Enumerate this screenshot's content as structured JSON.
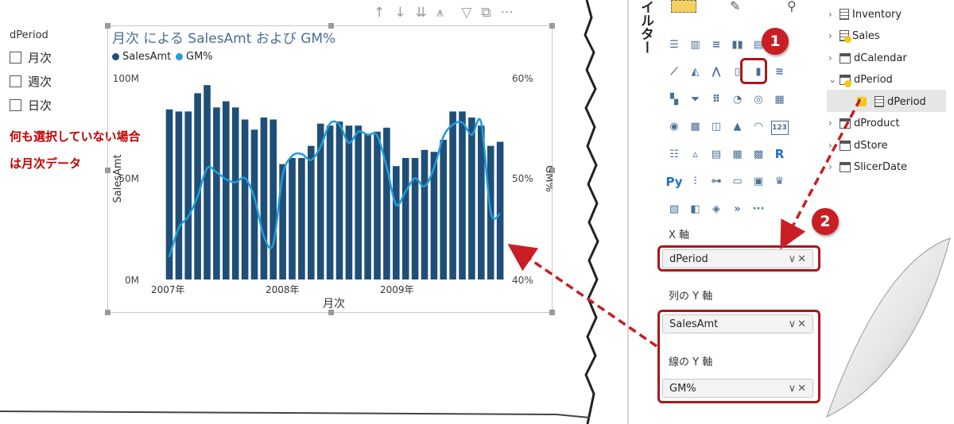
{
  "slicer": {
    "title": "dPeriod",
    "items": [
      "月次",
      "週次",
      "日次"
    ],
    "note_line1": "何も選択していない場合",
    "note_line2": "は月次データ"
  },
  "visual": {
    "title": "月次 による SalesAmt および GM%",
    "legend": [
      {
        "name": "SalesAmt",
        "color": "#1f4e79"
      },
      {
        "name": "GM%",
        "color": "#1f9ed8"
      }
    ],
    "header_icons": [
      "arrow-up-icon",
      "arrow-down-icon",
      "double-arrow-down-icon",
      "expand-hierarchy-icon",
      "filter-icon",
      "focus-mode-icon",
      "more-options-icon"
    ]
  },
  "chart_data": {
    "type": "bar",
    "title": "月次 による SalesAmt および GM%",
    "xlabel": "月次",
    "ylabel": "SalesAmt",
    "y2label": "GM%",
    "x_ticks": [
      "2007年",
      "2008年",
      "2009年"
    ],
    "y_ticks": [
      "0M",
      "50M",
      "100M"
    ],
    "y2_ticks": [
      "40%",
      "50%",
      "60%"
    ],
    "ylim": [
      0,
      100
    ],
    "y2lim": [
      40,
      60
    ],
    "categories": [
      "2007-01",
      "2007-02",
      "2007-03",
      "2007-04",
      "2007-05",
      "2007-06",
      "2007-07",
      "2007-08",
      "2007-09",
      "2007-10",
      "2007-11",
      "2007-12",
      "2008-01",
      "2008-02",
      "2008-03",
      "2008-04",
      "2008-05",
      "2008-06",
      "2008-07",
      "2008-08",
      "2008-09",
      "2008-10",
      "2008-11",
      "2008-12",
      "2009-01",
      "2009-02",
      "2009-03",
      "2009-04",
      "2009-05",
      "2009-06",
      "2009-07",
      "2009-08",
      "2009-09",
      "2009-10",
      "2009-11",
      "2009-12"
    ],
    "series": [
      {
        "name": "SalesAmt",
        "type": "bar",
        "color": "#1f4e79",
        "values": [
          84,
          83,
          83,
          92,
          96,
          85,
          88,
          85,
          79,
          74,
          80,
          79,
          57,
          60,
          60,
          66,
          77,
          76,
          78,
          76,
          76,
          72,
          73,
          75,
          56,
          60,
          60,
          64,
          63,
          69,
          83,
          83,
          80,
          76,
          66,
          68
        ]
      },
      {
        "name": "GM%",
        "type": "line",
        "color": "#1f9ed8",
        "values": [
          42.2,
          45.1,
          46.2,
          48.2,
          51.0,
          50.6,
          49.9,
          49.6,
          50.0,
          48.1,
          44.3,
          43.5,
          50.3,
          52.2,
          52.4,
          51.8,
          53.1,
          55.4,
          55.3,
          53.5,
          54.6,
          54.3,
          54.2,
          51.1,
          47.4,
          48.7,
          50.0,
          49.2,
          51.0,
          54.1,
          55.3,
          55.5,
          54.3,
          55.5,
          46.7,
          46.5
        ]
      }
    ]
  },
  "pane": {
    "vertical_label": "イルター",
    "badge1": "1",
    "badge2": "2",
    "viz_icons": [
      "stacked-bar-icon",
      "stacked-column-icon",
      "clustered-bar-icon",
      "clustered-column-icon",
      "100pct-bar-icon",
      "100pct-column-icon",
      "line-chart-icon",
      "area-chart-icon",
      "stacked-area-icon",
      "line-clustered-column-icon",
      "line-stacked-column-icon",
      "ribbon-chart-icon",
      "waterfall-icon",
      "funnel-icon",
      "scatter-icon",
      "pie-icon",
      "donut-icon",
      "treemap-icon",
      "map-icon",
      "filled-map-icon",
      "shape-map-icon",
      "azure-map-icon",
      "gauge-icon",
      "card-icon",
      "multi-row-card-icon",
      "kpi-icon",
      "slicer-icon",
      "table-icon",
      "matrix-icon",
      "r-visual-icon",
      "python-visual-icon",
      "key-influencers-icon",
      "decomposition-tree-icon",
      "qa-icon",
      "smart-narrative-icon",
      "goals-icon",
      "paginated-report-icon",
      "power-apps-icon",
      "power-automate-icon",
      "get-more-visuals-icon",
      "more-icon"
    ],
    "r_text": "R",
    "py_text": "Py",
    "card_text": "123",
    "more_text": "···",
    "x_axis_label": "X 軸",
    "x_axis_field": "dPeriod",
    "col_y_label": "列の Y 軸",
    "col_y_field": "SalesAmt",
    "line_y_label": "線の Y 軸",
    "line_y_field": "GM%",
    "well_controls": "∨✕"
  },
  "fields": [
    {
      "name": "Inventory",
      "icon": "table-icon",
      "expanded": false
    },
    {
      "name": "Sales",
      "icon": "table-icon",
      "expanded": false
    },
    {
      "name": "dCalendar",
      "icon": "table-icon",
      "expanded": false
    },
    {
      "name": "dPeriod",
      "icon": "table-icon",
      "expanded": true
    },
    {
      "name": "dPeriod",
      "icon": "calc-table-icon",
      "child": true,
      "checked": true
    },
    {
      "name": "dProduct",
      "icon": "table-icon",
      "expanded": false
    },
    {
      "name": "dStore",
      "icon": "table-icon",
      "expanded": false
    },
    {
      "name": "SlicerDate",
      "icon": "table-icon",
      "expanded": false
    }
  ]
}
